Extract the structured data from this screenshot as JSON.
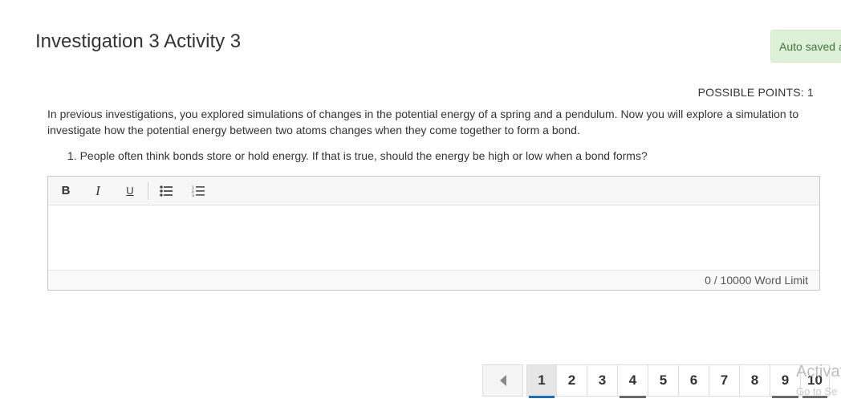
{
  "page": {
    "title": "Investigation 3 Activity 3",
    "autosave_text": "Auto saved a"
  },
  "points_label": "POSSIBLE POINTS: 1",
  "intro_text": "In previous investigations, you explored simulations of changes in the potential energy of a spring and a pendulum. Now you will explore a simulation to investigate how the potential energy between two atoms changes when they come together to form a bond.",
  "question": {
    "number": "1.",
    "text": "People often think bonds store or hold energy. If that is true, should the energy be high or low when a bond forms?"
  },
  "editor": {
    "toolbar": {
      "bold": "B",
      "italic": "I",
      "underline": "U"
    },
    "value": "",
    "counter_text": "0 / 10000 Word Limit"
  },
  "pagination": {
    "pages": [
      "1",
      "2",
      "3",
      "4",
      "5",
      "6",
      "7",
      "8",
      "9",
      "10"
    ],
    "active": "1"
  },
  "watermark": {
    "line1": "Activat",
    "line2": "Go to Se"
  },
  "colors": {
    "autosave_bg": "#dff0d8",
    "autosave_text": "#3c763d",
    "active_page_underline": "#1f6fb5",
    "visited_page_underline": "#6b6b6b"
  }
}
